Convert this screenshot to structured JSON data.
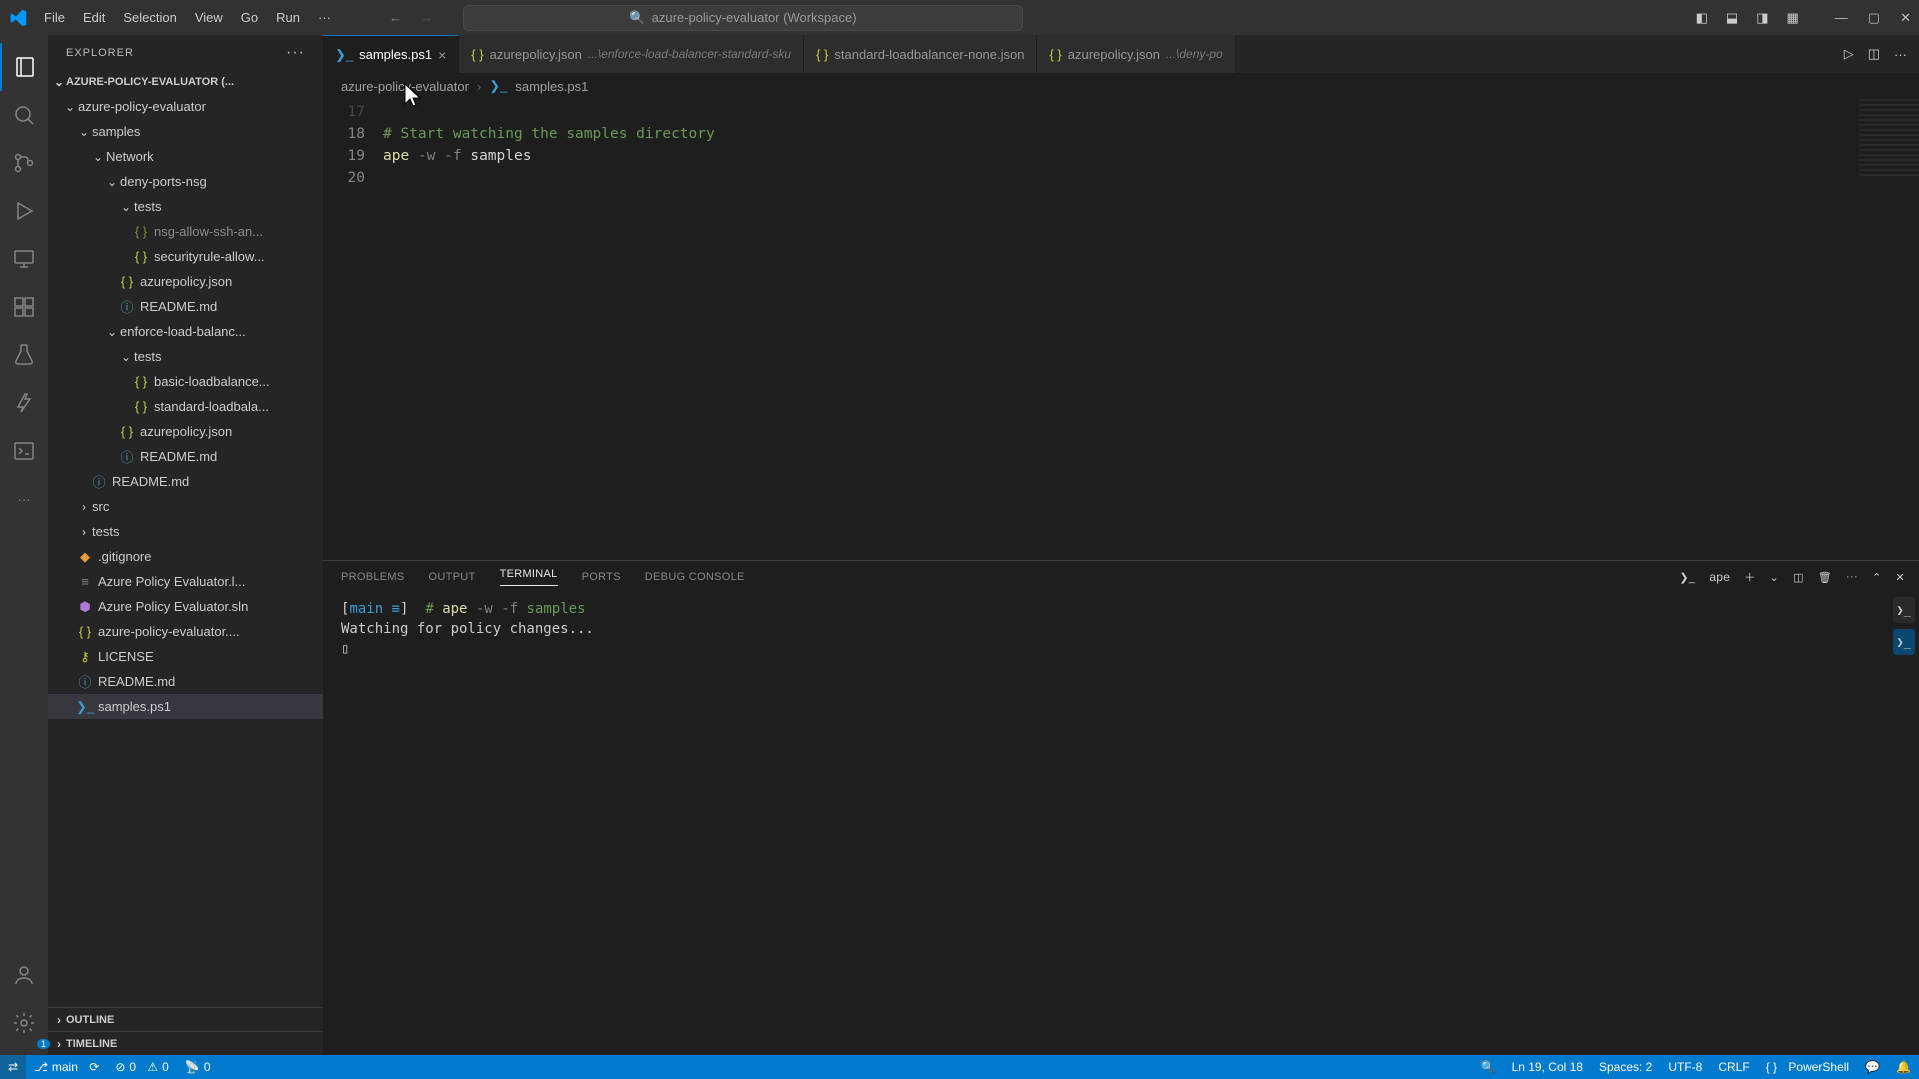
{
  "menu": {
    "file": "File",
    "edit": "Edit",
    "selection": "Selection",
    "view": "View",
    "go": "Go",
    "run": "Run",
    "more": "···"
  },
  "search": {
    "text": "azure-policy-evaluator (Workspace)"
  },
  "sidebar": {
    "title": "EXPLORER",
    "workspace": "AZURE-POLICY-EVALUATOR (...",
    "outline": "OUTLINE",
    "timeline": "TIMELINE",
    "tree": {
      "root": "azure-policy-evaluator",
      "samples": "samples",
      "network": "Network",
      "denyports": "deny-ports-nsg",
      "tests1": "tests",
      "nsgallow": "nsg-allow-ssh-an...",
      "secrule": "securityrule-allow...",
      "azpolicy1": "azurepolicy.json",
      "readme1": "README.md",
      "enforcelb": "enforce-load-balanc...",
      "tests2": "tests",
      "basiclb": "basic-loadbalance...",
      "stdlb": "standard-loadbala...",
      "azpolicy2": "azurepolicy.json",
      "readme2": "README.md",
      "readme3": "README.md",
      "src": "src",
      "tests3": "tests",
      "gitignore": ".gitignore",
      "apel": "Azure Policy Evaluator.l...",
      "apesln": "Azure Policy Evaluator.sln",
      "apejson": "azure-policy-evaluator....",
      "license": "LICENSE",
      "readme4": "README.md",
      "samplesps1": "samples.ps1"
    }
  },
  "tabs": {
    "t1": "samples.ps1",
    "t2": "azurepolicy.json",
    "t2hint": "...\\enforce-load-balancer-standard-sku",
    "t3": "standard-loadbalancer-none.json",
    "t4": "azurepolicy.json",
    "t4hint": "...\\deny-po"
  },
  "breadcrumb": {
    "p1": "azure-policy-evaluator",
    "p2": "samples.ps1"
  },
  "editor": {
    "ln17": "17",
    "ln18": "18",
    "ln19": "19",
    "ln20": "20",
    "comment": "# Start watching the samples directory",
    "cmd": "ape",
    "flag1": "-w",
    "flag2": "-f",
    "arg": "samples"
  },
  "panel": {
    "problems": "PROBLEMS",
    "output": "OUTPUT",
    "terminal": "TERMINAL",
    "ports": "PORTS",
    "debug": "DEBUG CONSOLE",
    "termlabel": "ape",
    "line1_pre": "[",
    "line1_branch": "main ≡",
    "line1_suf": "]",
    "line1_hash": "#",
    "line1_cmd": "ape",
    "line1_f1": "-w",
    "line1_f2": "-f",
    "line1_arg": "samples",
    "line2": "Watching for policy changes...",
    "cursor": "▯"
  },
  "status": {
    "branch": "main",
    "errors": "0",
    "warnings": "0",
    "ports": "0",
    "pos": "Ln 19, Col 18",
    "spaces": "Spaces: 2",
    "enc": "UTF-8",
    "eol": "CRLF",
    "lang": "PowerShell"
  }
}
